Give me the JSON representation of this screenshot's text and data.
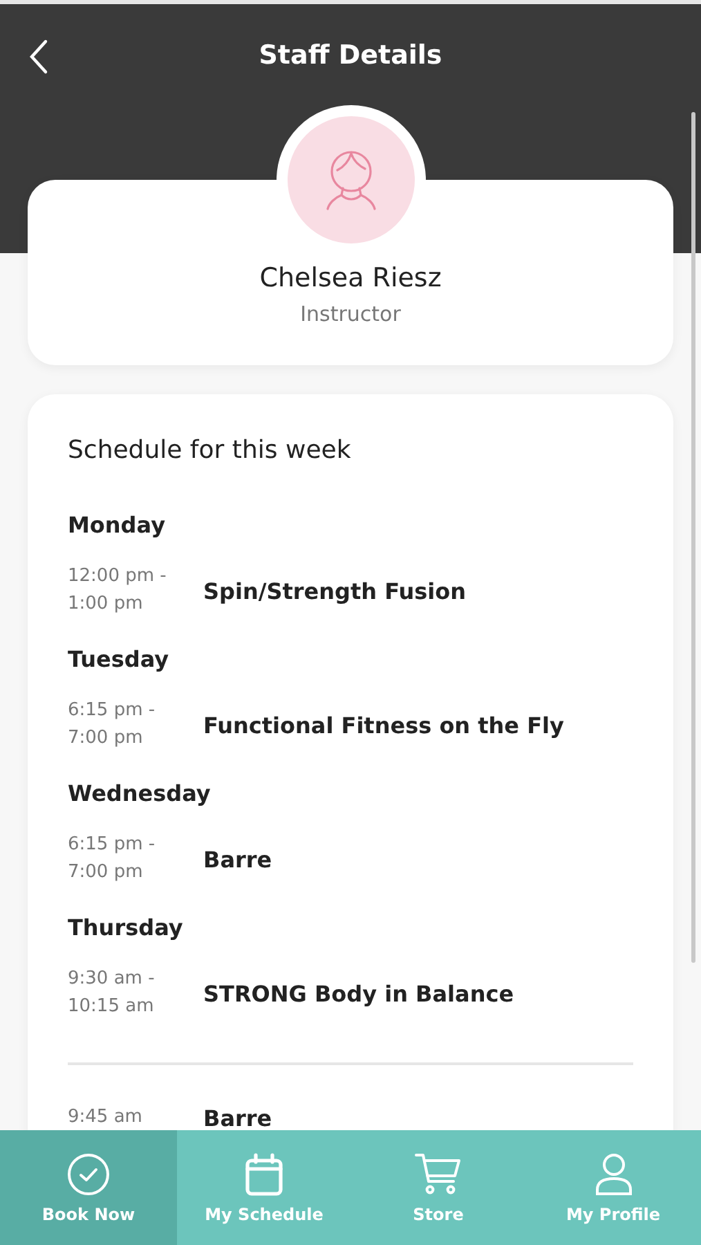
{
  "header": {
    "title": "Staff Details"
  },
  "staff": {
    "name": "Chelsea Riesz",
    "role": "Instructor"
  },
  "schedule": {
    "title": "Schedule for this week",
    "days": [
      {
        "day": "Monday",
        "classes": [
          {
            "time": [
              "12:00 pm -",
              "1:00 pm"
            ],
            "name": "Spin/Strength Fusion"
          }
        ]
      },
      {
        "day": "Tuesday",
        "classes": [
          {
            "time": [
              "6:15 pm -",
              "7:00 pm"
            ],
            "name": "Functional Fitness on the Fly"
          }
        ]
      },
      {
        "day": "Wednesday",
        "classes": [
          {
            "time": [
              "6:15 pm -",
              "7:00 pm"
            ],
            "name": "Barre"
          }
        ]
      },
      {
        "day": "Thursday",
        "classes": [
          {
            "time": [
              "9:30 am -",
              "10:15 am"
            ],
            "name": "STRONG Body in Balance"
          }
        ]
      }
    ],
    "after_divider": [
      {
        "time": [
          "9:45 am"
        ],
        "name": "Barre"
      }
    ]
  },
  "nav": [
    {
      "label": "Book Now",
      "kind": "check",
      "selected": true
    },
    {
      "label": "My Schedule",
      "kind": "calendar",
      "selected": false
    },
    {
      "label": "Store",
      "kind": "cart",
      "selected": false
    },
    {
      "label": "My Profile",
      "kind": "person",
      "selected": false
    }
  ]
}
